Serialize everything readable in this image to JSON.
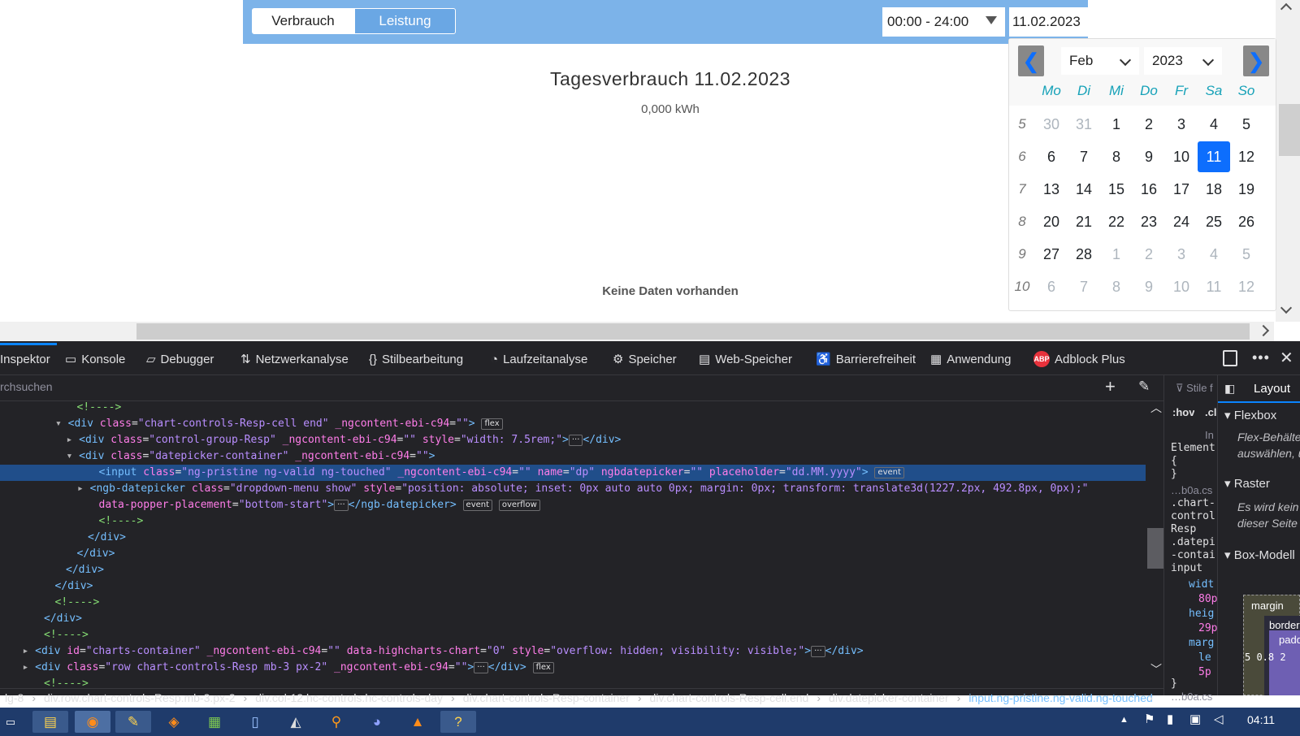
{
  "header": {
    "tab_consumption": "Verbrauch",
    "tab_power": "Leistung",
    "time_range": "00:00 - 24:00",
    "date_value": "11.02.2023"
  },
  "chart": {
    "title": "Tagesverbrauch 11.02.2023",
    "total": "0,000 kWh",
    "no_data": "Keine Daten vorhanden"
  },
  "datepicker": {
    "month": "Feb",
    "year": "2023",
    "weekdays": [
      "Mo",
      "Di",
      "Mi",
      "Do",
      "Fr",
      "Sa",
      "So"
    ],
    "weeks": [
      {
        "num": "5",
        "days": [
          "30",
          "31",
          "1",
          "2",
          "3",
          "4",
          "5"
        ]
      },
      {
        "num": "6",
        "days": [
          "6",
          "7",
          "8",
          "9",
          "10",
          "11",
          "12"
        ]
      },
      {
        "num": "7",
        "days": [
          "13",
          "14",
          "15",
          "16",
          "17",
          "18",
          "19"
        ]
      },
      {
        "num": "8",
        "days": [
          "20",
          "21",
          "22",
          "23",
          "24",
          "25",
          "26"
        ]
      },
      {
        "num": "9",
        "days": [
          "27",
          "28",
          "1",
          "2",
          "3",
          "4",
          "5"
        ]
      },
      {
        "num": "10",
        "days": [
          "6",
          "7",
          "8",
          "9",
          "10",
          "11",
          "12"
        ]
      }
    ],
    "selected_day": "11"
  },
  "devtools": {
    "tabs": [
      {
        "label": "Inspektor",
        "icon": "inspector-icon"
      },
      {
        "label": "Konsole",
        "icon": "console-icon"
      },
      {
        "label": "Debugger",
        "icon": "debugger-icon"
      },
      {
        "label": "Netzwerkanalyse",
        "icon": "network-icon"
      },
      {
        "label": "Stilbearbeitung",
        "icon": "style-editor-icon"
      },
      {
        "label": "Laufzeitanalyse",
        "icon": "performance-icon"
      },
      {
        "label": "Speicher",
        "icon": "memory-icon"
      },
      {
        "label": "Web-Speicher",
        "icon": "storage-icon"
      },
      {
        "label": "Barrierefreiheit",
        "icon": "accessibility-icon"
      },
      {
        "label": "Anwendung",
        "icon": "application-icon"
      },
      {
        "label": "Adblock Plus",
        "icon": "adblock-icon"
      }
    ],
    "search_placeholder": "rchsuchen",
    "code_lines": [
      {
        "indent": 7,
        "html": "<span class='cm'>&lt;!----&gt;</span>"
      },
      {
        "indent": 6,
        "arrow": "▾",
        "html": "<span class='tg'>&lt;div</span> <span class='at'>class</span>=<span class='av'>\"chart-controls-Resp-cell end\"</span> <span class='at'>_ngcontent-ebi-c94</span>=<span class='av'>\"\"</span><span class='tg'>&gt;</span> <span class='badge'>flex</span>"
      },
      {
        "indent": 7,
        "arrow": "▸",
        "html": "<span class='tg'>&lt;div</span> <span class='at'>class</span>=<span class='av'>\"control-group-Resp\"</span> <span class='at'>_ngcontent-ebi-c94</span>=<span class='av'>\"\"</span> <span class='at'>style</span>=<span class='av'>\"width: 7.5rem;\"</span><span class='tg'>&gt;</span><span class='badge'>···</span><span class='tg'>&lt;/div&gt;</span>"
      },
      {
        "indent": 7,
        "arrow": "▾",
        "html": "<span class='tg'>&lt;div</span> <span class='at'>class</span>=<span class='av'>\"datepicker-container\"</span> <span class='at'>_ngcontent-ebi-c94</span>=<span class='av'>\"\"</span><span class='tg'>&gt;</span>"
      },
      {
        "indent": 9,
        "sel": true,
        "html": "<span class='tg'>&lt;input</span> <span class='at'>class</span>=<span class='av'>\"ng-pristine ng-valid ng-touched\"</span> <span class='at'>_ngcontent-ebi-c94</span>=<span class='av'>\"\"</span> <span class='at'>name</span>=<span class='av'>\"dp\"</span> <span class='at'>ngbdatepicker</span>=<span class='av'>\"\"</span> <span class='at'>placeholder</span>=<span class='av'>\"dd.MM.yyyy\"</span><span class='tg'>&gt;</span> <span class='badge'>event</span>"
      },
      {
        "indent": 8,
        "arrow": "▸",
        "html": "<span class='tg'>&lt;ngb-datepicker</span> <span class='at'>class</span>=<span class='av'>\"dropdown-menu show\"</span> <span class='at'>style</span>=<span class='av'>\"position: absolute; inset: 0px auto auto 0px; margin: 0px; transform: translate3d(1227.2px, 492.8px, 0px);\"</span>"
      },
      {
        "indent": 9,
        "html": "<span class='at'>data-popper-placement</span>=<span class='av'>\"bottom-start\"</span><span class='tg'>&gt;</span><span class='badge'>···</span><span class='tg'>&lt;/ngb-datepicker&gt;</span> <span class='badge'>event</span> <span class='badge'>overflow</span>"
      },
      {
        "indent": 9,
        "html": "<span class='cm'>&lt;!----&gt;</span>"
      },
      {
        "indent": 8,
        "html": "<span class='tg'>&lt;/div&gt;</span>"
      },
      {
        "indent": 7,
        "html": "<span class='tg'>&lt;/div&gt;</span>"
      },
      {
        "indent": 6,
        "html": "<span class='tg'>&lt;/div&gt;</span>"
      },
      {
        "indent": 5,
        "html": "<span class='tg'>&lt;/div&gt;</span>"
      },
      {
        "indent": 5,
        "html": "<span class='cm'>&lt;!----&gt;</span>"
      },
      {
        "indent": 4,
        "html": "<span class='tg'>&lt;/div&gt;</span>"
      },
      {
        "indent": 4,
        "html": "<span class='cm'>&lt;!----&gt;</span>"
      },
      {
        "indent": 3,
        "arrow": "▸",
        "html": "<span class='tg'>&lt;div</span> <span class='at'>id</span>=<span class='av'>\"charts-container\"</span> <span class='at'>_ngcontent-ebi-c94</span>=<span class='av'>\"\"</span> <span class='at'>data-highcharts-chart</span>=<span class='av'>\"0\"</span> <span class='at'>style</span>=<span class='av'>\"overflow: hidden; visibility: visible;\"</span><span class='tg'>&gt;</span><span class='badge'>···</span><span class='tg'>&lt;/div&gt;</span>"
      },
      {
        "indent": 3,
        "arrow": "▸",
        "html": "<span class='tg'>&lt;div</span> <span class='at'>class</span>=<span class='av'>\"row chart-controls-Resp mb-3 px-2\"</span> <span class='at'>_ngcontent-ebi-c94</span>=<span class='av'>\"\"</span><span class='tg'>&gt;</span><span class='badge'>···</span><span class='tg'>&lt;/div&gt;</span> <span class='badge'>flex</span>"
      },
      {
        "indent": 4,
        "html": "<span class='cm'>&lt;!----&gt;</span>"
      }
    ],
    "breadcrumbs": [
      "lg-8",
      "div.row.chart-controls-Resp.mb-3.px-2",
      "div.col-12.hc-controls.hc-controls-day",
      "div.chart-controls-Resp-container",
      "div.chart-controls-Resp-cell.end",
      "div.datepicker-container",
      "input.ng-pristine.ng-valid.ng-touched"
    ],
    "rules_panel": {
      "filter": "Stile f",
      "hov": ":hov",
      "cls": ".cl",
      "element_in": "In",
      "element": "Element",
      "brace_open": "{",
      "brace_close": "}",
      "source": "…b0a.cs",
      "selector": [
        ".chart-",
        "control",
        "Resp",
        ".datepi",
        "-contai",
        "input"
      ],
      "props": [
        "widt",
        "80p",
        "heig",
        "29p",
        "marg",
        "le",
        "5p"
      ],
      "close": "}",
      "source2": "…b0a.cs"
    },
    "layout_panel": {
      "tab": "Layout",
      "flexbox": "Flexbox",
      "flex_hint": [
        "Flex-Behälte",
        "auswählen, u"
      ],
      "grid": "Raster",
      "grid_hint": [
        "Es wird kein",
        "dieser Seite v"
      ],
      "boxmodel": "Box-Modell",
      "margin": "margin",
      "border": "border",
      "padding": "padd",
      "values": "5  0.8  2"
    }
  },
  "taskbar": {
    "clock": "04:11"
  }
}
